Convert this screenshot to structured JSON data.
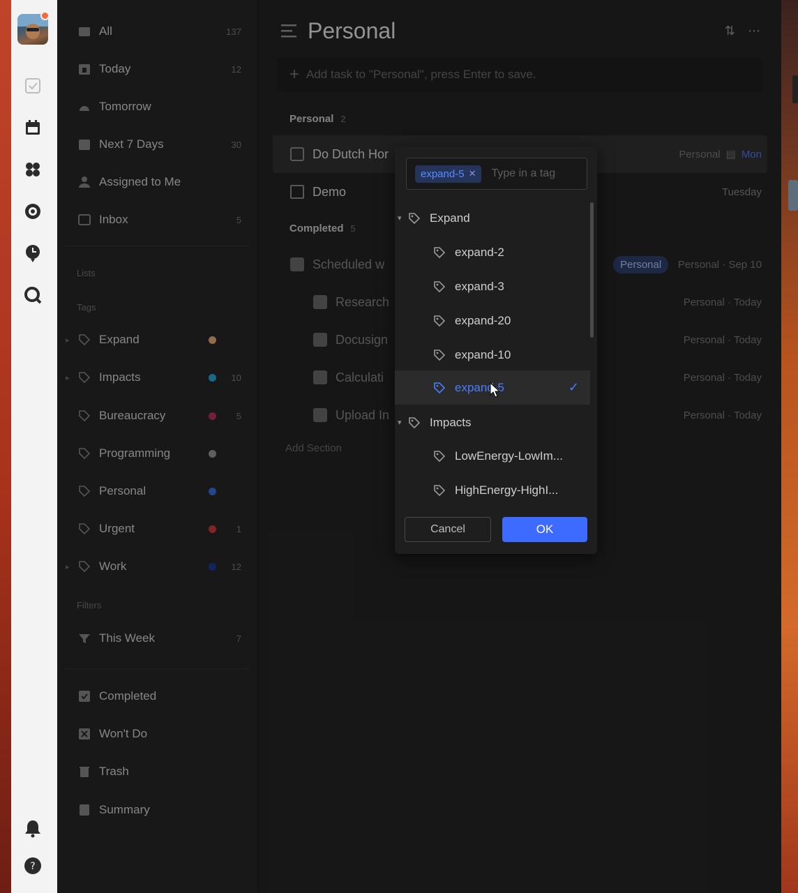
{
  "sidebar": {
    "smart_lists": [
      {
        "label": "All",
        "count": "137"
      },
      {
        "label": "Today",
        "count": "12"
      },
      {
        "label": "Tomorrow",
        "count": ""
      },
      {
        "label": "Next 7 Days",
        "count": "30"
      },
      {
        "label": "Assigned to Me",
        "count": ""
      },
      {
        "label": "Inbox",
        "count": "5"
      }
    ],
    "lists_section": "Lists",
    "tags_section": "Tags",
    "tags": [
      {
        "label": "Expand",
        "color": "#e8b07a",
        "count": ""
      },
      {
        "label": "Impacts",
        "color": "#2aa7d8",
        "count": "10"
      },
      {
        "label": "Bureaucracy",
        "color": "#b8325a",
        "count": "5"
      },
      {
        "label": "Programming",
        "color": "#9a9a9a",
        "count": ""
      },
      {
        "label": "Personal",
        "color": "#3b6fe0",
        "count": ""
      },
      {
        "label": "Urgent",
        "color": "#d43a3a",
        "count": "1"
      },
      {
        "label": "Work",
        "color": "#1f3c9a",
        "count": "12"
      }
    ],
    "filters_section": "Filters",
    "filters": [
      {
        "label": "This Week",
        "count": "7"
      }
    ],
    "bottom": [
      {
        "label": "Completed"
      },
      {
        "label": "Won't Do"
      },
      {
        "label": "Trash"
      },
      {
        "label": "Summary"
      }
    ]
  },
  "main": {
    "title": "Personal",
    "add_task_placeholder": "Add task to \"Personal\", press Enter to save.",
    "group_personal": "Personal",
    "group_personal_count": "2",
    "tasks": [
      {
        "title": "Do Dutch Hor",
        "list": "Personal",
        "date": "Mon"
      },
      {
        "title": "Demo",
        "list": "",
        "date": "Tuesday"
      }
    ],
    "group_completed": "Completed",
    "group_completed_count": "5",
    "completed_tasks": [
      {
        "title": "Scheduled w",
        "tag": "Personal",
        "meta": "Personal · Sep 10"
      },
      {
        "title": "Research",
        "meta": "Personal · Today"
      },
      {
        "title": "Docusign",
        "meta": "Personal · Today"
      },
      {
        "title": "Calculati",
        "meta": "Personal · Today"
      },
      {
        "title": "Upload In",
        "meta": "Personal · Today"
      }
    ],
    "add_section": "Add Section"
  },
  "tag_popup": {
    "selected_pill": "expand-5",
    "input_placeholder": "Type in a tag",
    "groups": [
      {
        "name": "Expand",
        "children": [
          "expand-2",
          "expand-3",
          "expand-20",
          "expand-10",
          "expand-5"
        ]
      },
      {
        "name": "Impacts",
        "children": [
          "LowEnergy-LowIm...",
          "HighEnergy-HighI..."
        ]
      }
    ],
    "selected_child": "expand-5",
    "cancel_label": "Cancel",
    "ok_label": "OK"
  },
  "colors": {
    "accent": "#3d6bff",
    "sidebar_bg": "#282828",
    "main_bg": "#252525",
    "popup_bg": "#1e1e1e"
  }
}
